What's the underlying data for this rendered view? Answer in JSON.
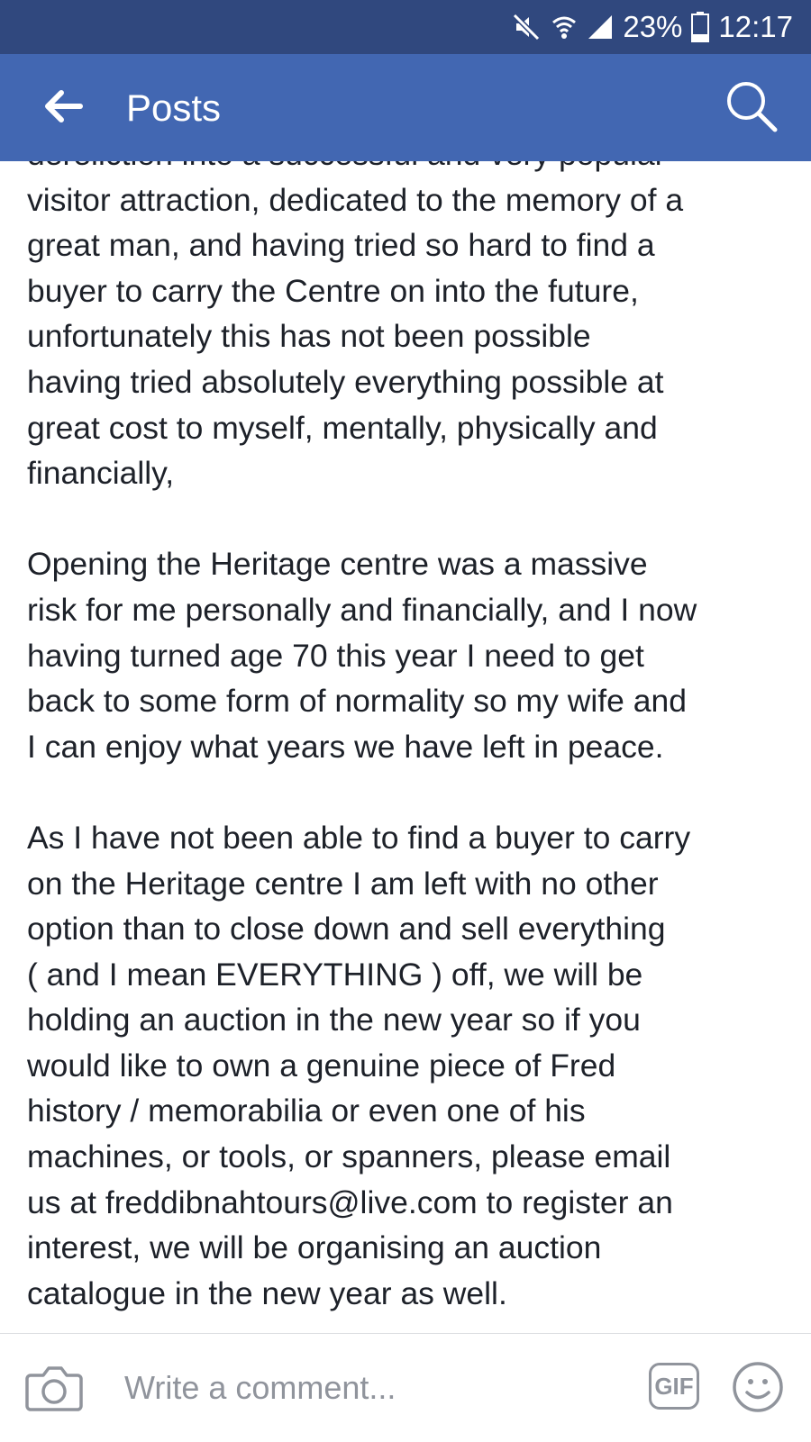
{
  "status_bar": {
    "battery_percent": "23%",
    "time": "12:17",
    "icons": [
      "mute-icon",
      "wifi-icon",
      "signal-icon",
      "battery-icon"
    ]
  },
  "app_bar": {
    "title": "Posts",
    "icons": [
      "back-arrow-icon",
      "search-icon"
    ]
  },
  "post": {
    "text": "dereliction into a successful and very popular\nvisitor attraction, dedicated to the memory of a\ngreat man, and having tried so hard to find a\nbuyer to carry the Centre on into the future,\nunfortunately this has not been possible\nhaving tried absolutely everything possible at\ngreat cost to myself, mentally, physically and\nfinancially,\n\nOpening the Heritage centre was a massive\nrisk for me personally and financially, and I now\nhaving turned age 70 this year I need to get\nback to some form of normality so my wife and\nI can enjoy what years we have left in peace.\n\nAs I have not been able to find a buyer to carry\non the Heritage centre I am left with no other\noption than to close down and sell everything\n( and I mean EVERYTHING ) off, we will be\nholding an auction in the new year so if you\nwould like to own a genuine piece of Fred\nhistory / memorabilia or even one of his\nmachines, or tools, or spanners, please email\nus at freddibnahtours@live.com to register an\ninterest, we will be organising an auction\ncatalogue in the new year as well."
  },
  "composer": {
    "placeholder": "Write a comment...",
    "gif_label": "GIF",
    "icons": [
      "camera-icon",
      "gif-icon",
      "emoji-icon"
    ]
  },
  "colors": {
    "status_bar_bg": "#30487e",
    "app_bar_bg": "#4267b2",
    "text": "#1d2129",
    "muted": "#90949c"
  }
}
